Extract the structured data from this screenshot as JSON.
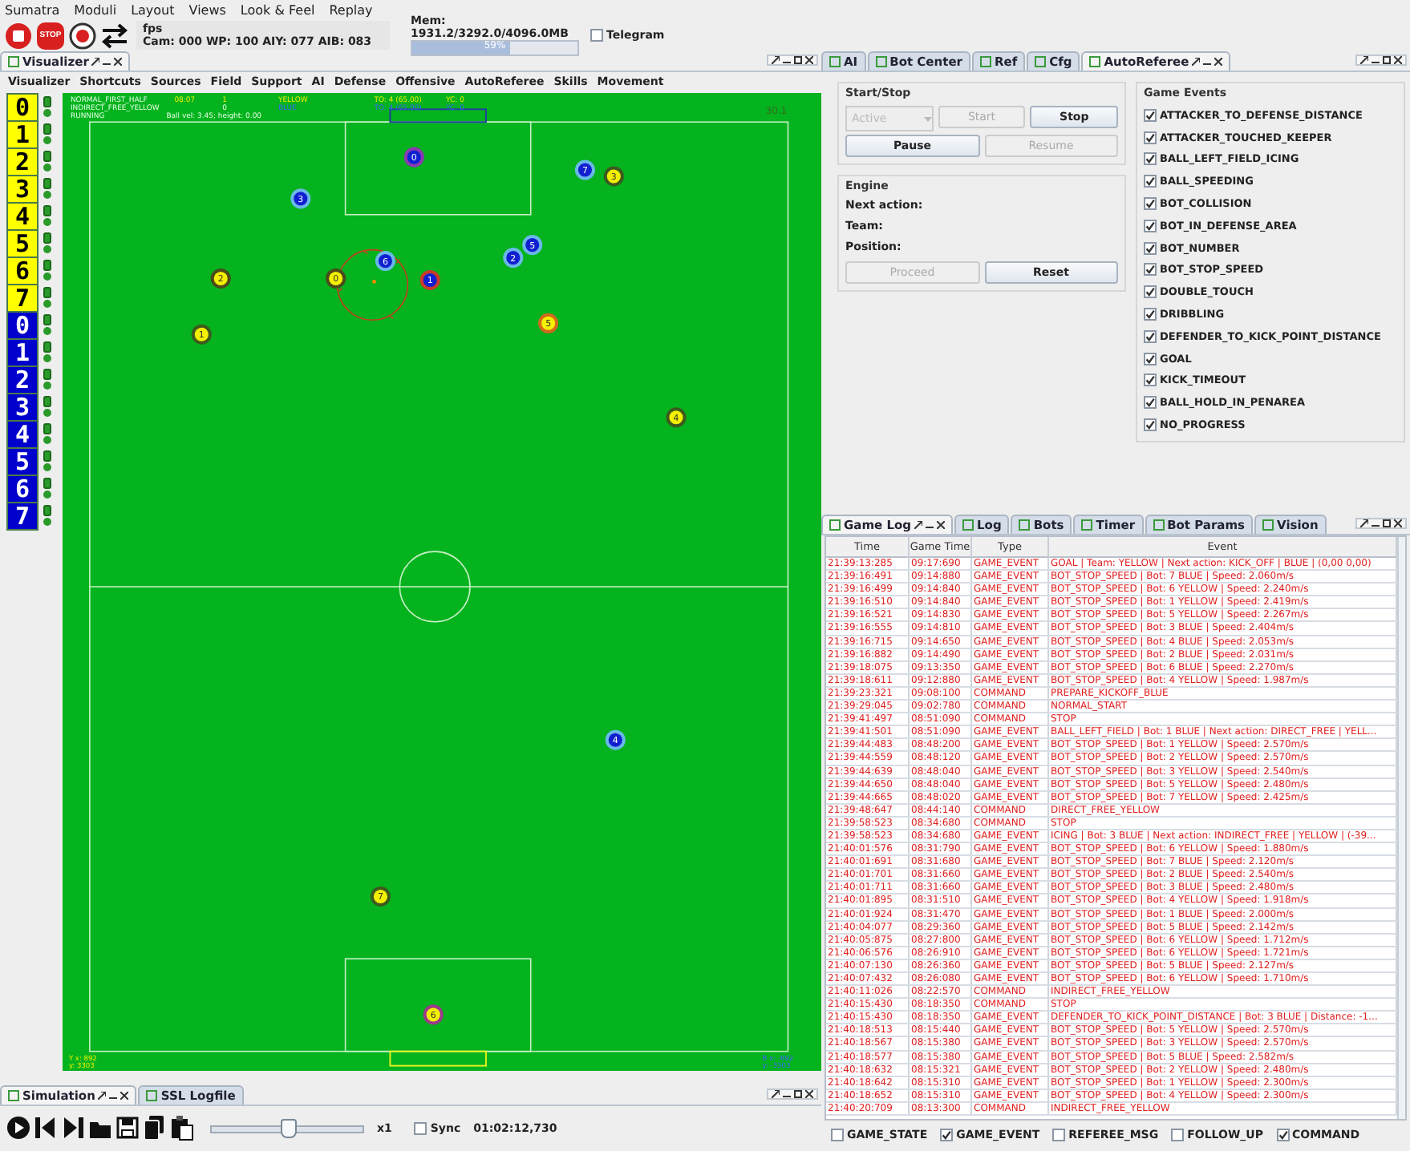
{
  "menu": [
    "Sumatra",
    "Moduli",
    "Layout",
    "Views",
    "Look & Feel",
    "Replay"
  ],
  "toolbar": {
    "stop_sign": "STOP",
    "fps": "fps",
    "stats": "Cam: 000 WP: 100 AIY: 077 AIB: 083",
    "memory": "Mem: 1931.2/3292.0/4096.0MB",
    "memory_bar": {
      "level": 0.59,
      "reading": "59%"
    },
    "telegram": {
      "label": "Telegram",
      "checked": false
    }
  },
  "visualizer": {
    "tabs": [
      {
        "label": "Visualizer",
        "selected": true
      }
    ],
    "menu": [
      "Visualizer",
      "Shortcuts",
      "Sources",
      "Field",
      "Support",
      "AI",
      "Defense",
      "Offensive",
      "AutoReferee",
      "Skills",
      "Movement"
    ],
    "bots": [
      {
        "number": "0",
        "kind": "yellow"
      },
      {
        "number": "1",
        "kind": "yellow"
      },
      {
        "number": "2",
        "kind": "yellow"
      },
      {
        "number": "3",
        "kind": "yellow"
      },
      {
        "number": "4",
        "kind": "yellow"
      },
      {
        "number": "5",
        "kind": "yellow"
      },
      {
        "number": "6",
        "kind": "yellow"
      },
      {
        "number": "7",
        "kind": "yellow"
      },
      {
        "number": "0",
        "kind": "blue"
      },
      {
        "number": "1",
        "kind": "blue"
      },
      {
        "number": "2",
        "kind": "blue"
      },
      {
        "number": "3",
        "kind": "blue"
      },
      {
        "number": "4",
        "kind": "blue"
      },
      {
        "number": "5",
        "kind": "blue"
      },
      {
        "number": "6",
        "kind": "blue"
      },
      {
        "number": "7",
        "kind": "blue"
      }
    ],
    "field": {
      "info": [
        {
          "kind": "yellow",
          "cells": [
            "NORMAL_FIRST_HALF",
            "08:07",
            "1",
            "YELLOW",
            "TO: 4 (65.00)",
            "YC: 0"
          ]
        },
        {
          "kind": "blue",
          "cells": [
            "INDIRECT_FREE_YELLOW",
            "0",
            "BLUE",
            "TO: 4 (65.00)",
            "YC: 0"
          ]
        },
        {
          "kind": "plain",
          "cells": [
            "RUNNING",
            "Ball vel: 3.45; height: 0.00"
          ]
        }
      ],
      "fps": "30.1",
      "coords": [
        {
          "kind": "yellow",
          "lines": [
            "Y x: 892",
            "y: 3303"
          ]
        },
        {
          "kind": "blue",
          "lines": [
            "B x: -892",
            "y: -3303"
          ]
        }
      ],
      "robots": [
        {
          "number": "0",
          "kind": "yellow",
          "color": "#4a4a1a"
        },
        {
          "number": "1",
          "kind": "yellow",
          "color": "#3d5a1e"
        },
        {
          "number": "2",
          "kind": "yellow",
          "color": "#4a4a1a"
        },
        {
          "number": "3",
          "kind": "yellow",
          "color": "#3d5a1e"
        },
        {
          "number": "4",
          "kind": "yellow",
          "color": "#3d5a1e"
        },
        {
          "number": "5",
          "kind": "yellow",
          "color": "#d2691e"
        },
        {
          "number": "6",
          "kind": "yellow",
          "color": "#9b3a8c"
        },
        {
          "number": "7",
          "kind": "yellow",
          "color": "#3d5a1e"
        },
        {
          "number": "0",
          "kind": "blue",
          "color": "#8a3ab0"
        },
        {
          "number": "1",
          "kind": "blue",
          "color": "#c83a2a"
        },
        {
          "number": "2",
          "kind": "blue",
          "color": "#6ab8e8"
        },
        {
          "number": "3",
          "kind": "blue",
          "color": "#6ab8e8"
        },
        {
          "number": "4",
          "kind": "blue",
          "color": "#6ab8e8"
        },
        {
          "number": "5",
          "kind": "blue",
          "color": "#6ab8e8"
        },
        {
          "number": "6",
          "kind": "blue",
          "color": "#6ab8e8"
        },
        {
          "number": "7",
          "kind": "blue",
          "color": "#6ab8e8"
        }
      ]
    }
  },
  "simulation": {
    "tabs": [
      {
        "label": "Simulation",
        "selected": true
      },
      {
        "label": "SSL Logfile",
        "selected": false
      }
    ],
    "speed": {
      "level": 0.5
    },
    "speed_label": "x1",
    "sync": {
      "label": "Sync",
      "checked": false
    },
    "time": "01:02:12,730"
  },
  "auto_referee": {
    "tabs": [
      {
        "label": "AI",
        "selected": false
      },
      {
        "label": "Bot Center",
        "selected": false
      },
      {
        "label": "Ref",
        "selected": false
      },
      {
        "label": "Cfg",
        "selected": false
      },
      {
        "label": "AutoReferee",
        "selected": true
      }
    ],
    "start_stop": {
      "title": "Start/Stop",
      "mode": {
        "value": "Active",
        "disabled": true
      },
      "buttons": [
        {
          "label": "Start",
          "disabled": true
        },
        {
          "label": "Stop",
          "disabled": false
        },
        {
          "label": "Pause",
          "disabled": false
        },
        {
          "label": "Resume",
          "disabled": true
        }
      ]
    },
    "engine": {
      "title": "Engine",
      "fields": [
        "Next action:",
        "Team:",
        "Position:"
      ],
      "buttons": [
        {
          "label": "Proceed",
          "disabled": true
        },
        {
          "label": "Reset",
          "disabled": false
        }
      ]
    },
    "game_events": {
      "title": "Game Events",
      "items": [
        {
          "label": "ATTACKER_TO_DEFENSE_DISTANCE",
          "checked": true
        },
        {
          "label": "ATTACKER_TOUCHED_KEEPER",
          "checked": true
        },
        {
          "label": "BALL_LEFT_FIELD_ICING",
          "checked": true
        },
        {
          "label": "BALL_SPEEDING",
          "checked": true
        },
        {
          "label": "BOT_COLLISION",
          "checked": true
        },
        {
          "label": "BOT_IN_DEFENSE_AREA",
          "checked": true
        },
        {
          "label": "BOT_NUMBER",
          "checked": true
        },
        {
          "label": "BOT_STOP_SPEED",
          "checked": true
        },
        {
          "label": "DOUBLE_TOUCH",
          "checked": true
        },
        {
          "label": "DRIBBLING",
          "checked": true
        },
        {
          "label": "DEFENDER_TO_KICK_POINT_DISTANCE",
          "checked": true
        },
        {
          "label": "GOAL",
          "checked": true
        },
        {
          "label": "KICK_TIMEOUT",
          "checked": true
        },
        {
          "label": "BALL_HOLD_IN_PENAREA",
          "checked": true
        },
        {
          "label": "NO_PROGRESS",
          "checked": true
        }
      ]
    }
  },
  "game_log": {
    "tabs": [
      {
        "label": "Game Log",
        "selected": true
      },
      {
        "label": "Log",
        "selected": false
      },
      {
        "label": "Bots",
        "selected": false
      },
      {
        "label": "Timer",
        "selected": false
      },
      {
        "label": "Bot Params",
        "selected": false
      },
      {
        "label": "Vision",
        "selected": false
      }
    ],
    "columns": [
      "Time",
      "Game Time",
      "Type",
      "Event"
    ],
    "rows": [
      [
        "21:39:13:285",
        "09:17:690",
        "GAME_EVENT",
        "GOAL | Team: YELLOW | Next action: KICK_OFF | BLUE | (0,00 0,00)"
      ],
      [
        "21:39:16:491",
        "09:14:880",
        "GAME_EVENT",
        "BOT_STOP_SPEED | Bot: 7 BLUE | Speed: 2.060m/s"
      ],
      [
        "21:39:16:499",
        "09:14:840",
        "GAME_EVENT",
        "BOT_STOP_SPEED | Bot: 6 YELLOW | Speed: 2.240m/s"
      ],
      [
        "21:39:16:510",
        "09:14:840",
        "GAME_EVENT",
        "BOT_STOP_SPEED | Bot: 1 YELLOW | Speed: 2.419m/s"
      ],
      [
        "21:39:16:521",
        "09:14:830",
        "GAME_EVENT",
        "BOT_STOP_SPEED | Bot: 5 YELLOW | Speed: 2.267m/s"
      ],
      [
        "21:39:16:555",
        "09:14:810",
        "GAME_EVENT",
        "BOT_STOP_SPEED | Bot: 3 BLUE | Speed: 2.404m/s"
      ],
      [
        "21:39:16:715",
        "09:14:650",
        "GAME_EVENT",
        "BOT_STOP_SPEED | Bot: 4 BLUE | Speed: 2.053m/s"
      ],
      [
        "21:39:16:882",
        "09:14:490",
        "GAME_EVENT",
        "BOT_STOP_SPEED | Bot: 2 BLUE | Speed: 2.031m/s"
      ],
      [
        "21:39:18:075",
        "09:13:350",
        "GAME_EVENT",
        "BOT_STOP_SPEED | Bot: 6 BLUE | Speed: 2.270m/s"
      ],
      [
        "21:39:18:611",
        "09:12:880",
        "GAME_EVENT",
        "BOT_STOP_SPEED | Bot: 4 YELLOW | Speed: 1.987m/s"
      ],
      [
        "21:39:23:321",
        "09:08:100",
        "COMMAND",
        "PREPARE_KICKOFF_BLUE"
      ],
      [
        "21:39:29:045",
        "09:02:780",
        "COMMAND",
        "NORMAL_START"
      ],
      [
        "21:39:41:497",
        "08:51:090",
        "COMMAND",
        "STOP"
      ],
      [
        "21:39:41:501",
        "08:51:090",
        "GAME_EVENT",
        "BALL_LEFT_FIELD | Bot: 1 BLUE | Next action: DIRECT_FREE | YELL..."
      ],
      [
        "21:39:44:483",
        "08:48:200",
        "GAME_EVENT",
        "BOT_STOP_SPEED | Bot: 1 YELLOW | Speed: 2.570m/s"
      ],
      [
        "21:39:44:559",
        "08:48:120",
        "GAME_EVENT",
        "BOT_STOP_SPEED | Bot: 2 YELLOW | Speed: 2.570m/s"
      ],
      [
        "21:39:44:639",
        "08:48:040",
        "GAME_EVENT",
        "BOT_STOP_SPEED | Bot: 3 YELLOW | Speed: 2.540m/s"
      ],
      [
        "21:39:44:650",
        "08:48:040",
        "GAME_EVENT",
        "BOT_STOP_SPEED | Bot: 5 YELLOW | Speed: 2.480m/s"
      ],
      [
        "21:39:44:665",
        "08:48:020",
        "GAME_EVENT",
        "BOT_STOP_SPEED | Bot: 7 YELLOW | Speed: 2.425m/s"
      ],
      [
        "21:39:48:647",
        "08:44:140",
        "COMMAND",
        "DIRECT_FREE_YELLOW"
      ],
      [
        "21:39:58:523",
        "08:34:680",
        "COMMAND",
        "STOP"
      ],
      [
        "21:39:58:523",
        "08:34:680",
        "GAME_EVENT",
        "ICING | Bot: 3 BLUE | Next action: INDIRECT_FREE | YELLOW | (-39..."
      ],
      [
        "21:40:01:576",
        "08:31:790",
        "GAME_EVENT",
        "BOT_STOP_SPEED | Bot: 6 YELLOW | Speed: 1.880m/s"
      ],
      [
        "21:40:01:691",
        "08:31:680",
        "GAME_EVENT",
        "BOT_STOP_SPEED | Bot: 7 BLUE | Speed: 2.120m/s"
      ],
      [
        "21:40:01:701",
        "08:31:660",
        "GAME_EVENT",
        "BOT_STOP_SPEED | Bot: 2 BLUE | Speed: 2.540m/s"
      ],
      [
        "21:40:01:711",
        "08:31:660",
        "GAME_EVENT",
        "BOT_STOP_SPEED | Bot: 3 BLUE | Speed: 2.480m/s"
      ],
      [
        "21:40:01:895",
        "08:31:510",
        "GAME_EVENT",
        "BOT_STOP_SPEED | Bot: 4 YELLOW | Speed: 1.918m/s"
      ],
      [
        "21:40:01:924",
        "08:31:470",
        "GAME_EVENT",
        "BOT_STOP_SPEED | Bot: 1 BLUE | Speed: 2.000m/s"
      ],
      [
        "21:40:04:077",
        "08:29:360",
        "GAME_EVENT",
        "BOT_STOP_SPEED | Bot: 5 BLUE | Speed: 2.142m/s"
      ],
      [
        "21:40:05:875",
        "08:27:800",
        "GAME_EVENT",
        "BOT_STOP_SPEED | Bot: 6 YELLOW | Speed: 1.712m/s"
      ],
      [
        "21:40:06:576",
        "08:26:910",
        "GAME_EVENT",
        "BOT_STOP_SPEED | Bot: 6 YELLOW | Speed: 1.721m/s"
      ],
      [
        "21:40:07:130",
        "08:26:360",
        "GAME_EVENT",
        "BOT_STOP_SPEED | Bot: 5 BLUE | Speed: 2.127m/s"
      ],
      [
        "21:40:07:432",
        "08:26:080",
        "GAME_EVENT",
        "BOT_STOP_SPEED | Bot: 6 YELLOW | Speed: 1.710m/s"
      ],
      [
        "21:40:11:026",
        "08:22:570",
        "COMMAND",
        "INDIRECT_FREE_YELLOW"
      ],
      [
        "21:40:15:430",
        "08:18:350",
        "COMMAND",
        "STOP"
      ],
      [
        "21:40:15:430",
        "08:18:350",
        "GAME_EVENT",
        "DEFENDER_TO_KICK_POINT_DISTANCE | Bot: 3 BLUE | Distance: -1..."
      ],
      [
        "21:40:18:513",
        "08:15:440",
        "GAME_EVENT",
        "BOT_STOP_SPEED | Bot: 5 YELLOW | Speed: 2.570m/s"
      ],
      [
        "21:40:18:567",
        "08:15:380",
        "GAME_EVENT",
        "BOT_STOP_SPEED | Bot: 3 YELLOW | Speed: 2.570m/s"
      ],
      [
        "21:40:18:577",
        "08:15:380",
        "GAME_EVENT",
        "BOT_STOP_SPEED | Bot: 5 BLUE | Speed: 2.582m/s"
      ],
      [
        "21:40:18:632",
        "08:15:321",
        "GAME_EVENT",
        "BOT_STOP_SPEED | Bot: 2 YELLOW | Speed: 2.480m/s"
      ],
      [
        "21:40:18:642",
        "08:15:310",
        "GAME_EVENT",
        "BOT_STOP_SPEED | Bot: 1 YELLOW | Speed: 2.300m/s"
      ],
      [
        "21:40:18:652",
        "08:15:310",
        "GAME_EVENT",
        "BOT_STOP_SPEED | Bot: 4 YELLOW | Speed: 2.300m/s"
      ],
      [
        "21:40:20:709",
        "08:13:300",
        "COMMAND",
        "INDIRECT_FREE_YELLOW"
      ]
    ],
    "filters": [
      {
        "label": "GAME_STATE",
        "checked": false
      },
      {
        "label": "GAME_EVENT",
        "checked": true
      },
      {
        "label": "REFEREE_MSG",
        "checked": false
      },
      {
        "label": "FOLLOW_UP",
        "checked": false
      },
      {
        "label": "COMMAND",
        "checked": true
      }
    ]
  }
}
